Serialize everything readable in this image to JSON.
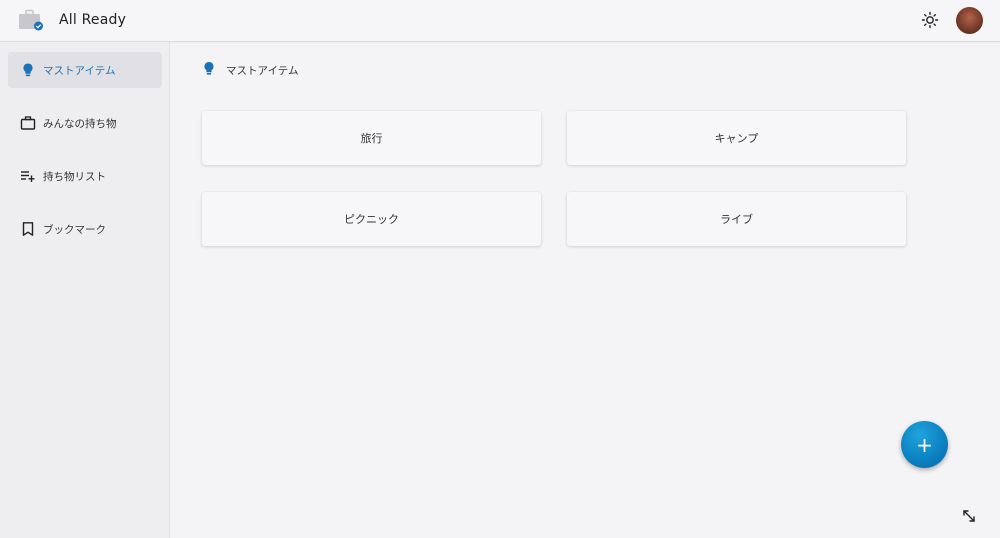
{
  "header": {
    "app_title": "All Ready"
  },
  "sidebar": {
    "items": [
      {
        "label": "マストアイテム",
        "icon": "lightbulb-icon",
        "active": true
      },
      {
        "label": "みんなの持ち物",
        "icon": "briefcase-icon",
        "active": false
      },
      {
        "label": "持ち物リスト",
        "icon": "playlist-add-icon",
        "active": false
      },
      {
        "label": "ブックマーク",
        "icon": "bookmark-icon",
        "active": false
      }
    ]
  },
  "main": {
    "section_title": "マストアイテム",
    "cards": [
      {
        "label": "旅行"
      },
      {
        "label": "キャンプ"
      },
      {
        "label": "ピクニック"
      },
      {
        "label": "ライブ"
      }
    ],
    "fab_label": "+"
  },
  "colors": {
    "accent": "#1a73b8",
    "fab": "#0b7fc0",
    "background": "#f4f4f6",
    "sidebar": "#eeedf0"
  }
}
